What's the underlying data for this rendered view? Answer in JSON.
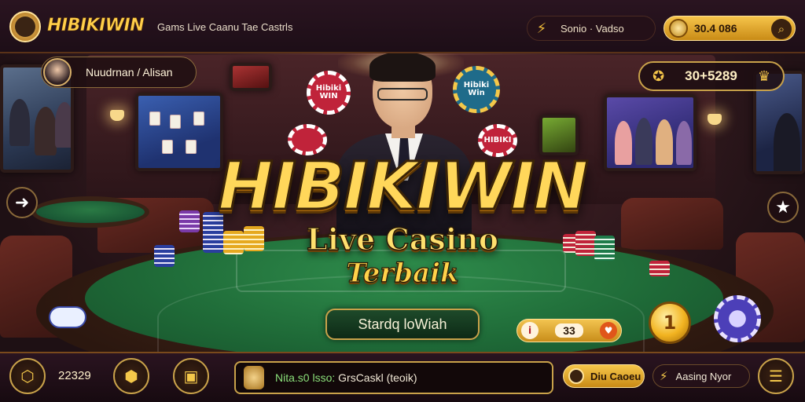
{
  "header": {
    "brand": "HIBIKIWIN",
    "tagline": "Gams Live Caanu Tae Castrls",
    "search_label": "Sonio · Vadso",
    "balance": "30.4 086",
    "search_icon": "magnifier-icon"
  },
  "player": {
    "name": "Nuudrnan / Alisan"
  },
  "jackpot": {
    "value": "30+5289"
  },
  "hero": {
    "title": "HIBIKIWIN",
    "subtitle": "Live Casino",
    "subtitle2": "Terbaik",
    "cta_label": "Stardq loWiah"
  },
  "table": {
    "bet_amount": "33",
    "coin_value": "1",
    "chip_labels": [
      "Hibiki WIN",
      "Hibiki Win",
      "HIBIKI"
    ]
  },
  "footer": {
    "count": "22329",
    "chat_prefix": "Nita.s0 lsso:",
    "chat_text": "GrsCaskl (teoik)",
    "action_primary": "Diu Caoeu",
    "action_secondary": "Aasing Nyor"
  },
  "colors": {
    "accent_gold": "#f4c84a",
    "felt_green": "#1f6b38",
    "bar_bg": "#1d0e17"
  }
}
